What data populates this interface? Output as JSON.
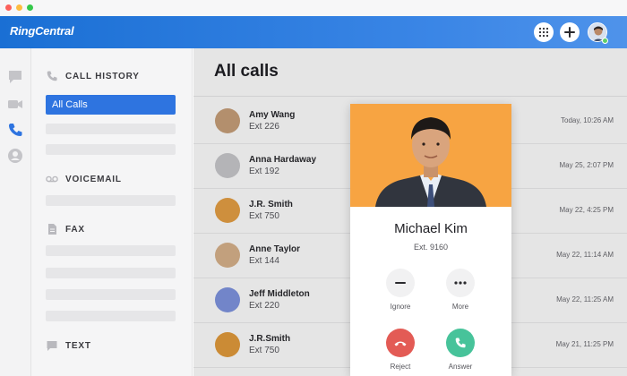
{
  "app": {
    "brand": "RingCentral"
  },
  "colors": {
    "accent": "#2e74e0",
    "topbar": "#1a6fd4",
    "card_photo_bg": "#f7a442",
    "reject": "#e35b55",
    "answer": "#47c39a"
  },
  "topbar": {
    "dialpad_icon": "dialpad-icon",
    "add_icon": "plus-icon",
    "avatar": "user-avatar"
  },
  "rail": {
    "icons": [
      "message-icon",
      "video-icon",
      "phone-icon",
      "contacts-icon"
    ]
  },
  "sidebar": {
    "call_history": {
      "title": "CALL HISTORY",
      "selected": "All Calls"
    },
    "voicemail": {
      "title": "VOICEMAIL"
    },
    "fax": {
      "title": "FAX"
    },
    "text": {
      "title": "TEXT"
    }
  },
  "main": {
    "title": "All calls",
    "calls": [
      {
        "name": "Amy Wang",
        "ext": "Ext 226",
        "time": "Today, 10:26 AM",
        "avatar_color": "#c8a07a"
      },
      {
        "name": "Anna Hardaway",
        "ext": "Ext 192",
        "time": "May 25, 2:07 PM",
        "avatar_color": "#c9c9cc"
      },
      {
        "name": "J.R. Smith",
        "ext": "Ext 750",
        "time": "May 22, 4:25 PM",
        "avatar_color": "#e6a045"
      },
      {
        "name": "Anne Taylor",
        "ext": "Ext 144",
        "time": "May 22, 11:14 AM",
        "avatar_color": "#d9b38c"
      },
      {
        "name": "Jeff Middleton",
        "ext": "Ext 220",
        "time": "May 22, 11:25 AM",
        "avatar_color": "#7f95e0"
      },
      {
        "name": "J.R.Smith",
        "ext": "Ext 750",
        "time": "May 21, 11:25 PM",
        "avatar_color": "#e39b3c"
      }
    ]
  },
  "incoming": {
    "name": "Michael Kim",
    "ext": "Ext. 9160",
    "ignore_label": "Ignore",
    "more_label": "More",
    "reject_label": "Reject",
    "answer_label": "Answer"
  }
}
